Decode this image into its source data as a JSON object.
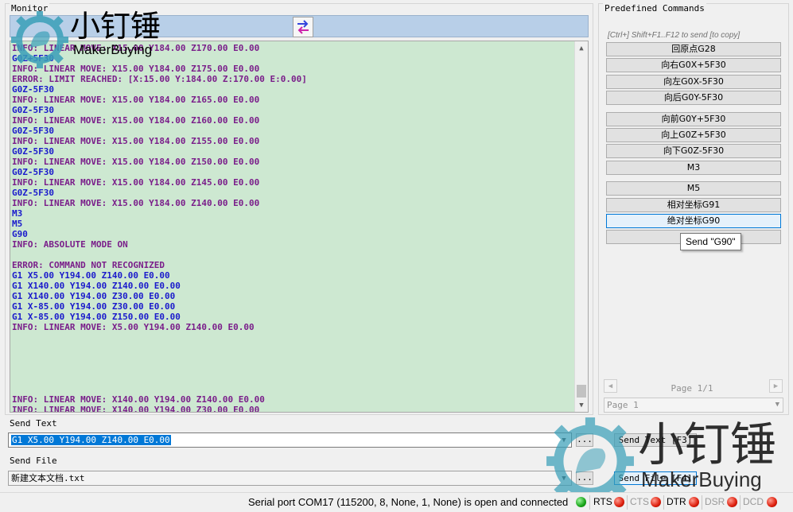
{
  "monitor": {
    "title": "Monitor",
    "lines": [
      {
        "text": "INFO: LINEAR MOVE: X15.00 Y184.00 Z170.00 E0.00",
        "kind": "info"
      },
      {
        "text": "G0Z+5F30",
        "kind": "cmd"
      },
      {
        "text": "INFO: LINEAR MOVE: X15.00 Y184.00 Z175.00 E0.00",
        "kind": "info"
      },
      {
        "text": "ERROR: LIMIT REACHED: [X:15.00 Y:184.00 Z:170.00 E:0.00]",
        "kind": "error"
      },
      {
        "text": "G0Z-5F30",
        "kind": "cmd"
      },
      {
        "text": "INFO: LINEAR MOVE: X15.00 Y184.00 Z165.00 E0.00",
        "kind": "info"
      },
      {
        "text": "G0Z-5F30",
        "kind": "cmd"
      },
      {
        "text": "INFO: LINEAR MOVE: X15.00 Y184.00 Z160.00 E0.00",
        "kind": "info"
      },
      {
        "text": "G0Z-5F30",
        "kind": "cmd"
      },
      {
        "text": "INFO: LINEAR MOVE: X15.00 Y184.00 Z155.00 E0.00",
        "kind": "info"
      },
      {
        "text": "G0Z-5F30",
        "kind": "cmd"
      },
      {
        "text": "INFO: LINEAR MOVE: X15.00 Y184.00 Z150.00 E0.00",
        "kind": "info"
      },
      {
        "text": "G0Z-5F30",
        "kind": "cmd"
      },
      {
        "text": "INFO: LINEAR MOVE: X15.00 Y184.00 Z145.00 E0.00",
        "kind": "info"
      },
      {
        "text": "G0Z-5F30",
        "kind": "cmd"
      },
      {
        "text": "INFO: LINEAR MOVE: X15.00 Y184.00 Z140.00 E0.00",
        "kind": "info"
      },
      {
        "text": "M3",
        "kind": "cmd"
      },
      {
        "text": "M5",
        "kind": "cmd"
      },
      {
        "text": "G90",
        "kind": "cmd"
      },
      {
        "text": "INFO: ABSOLUTE MODE ON",
        "kind": "info"
      },
      {
        "text": "",
        "kind": "info"
      },
      {
        "text": "ERROR: COMMAND NOT RECOGNIZED",
        "kind": "error"
      },
      {
        "text": "G1 X5.00 Y194.00 Z140.00 E0.00",
        "kind": "cmd"
      },
      {
        "text": "G1 X140.00 Y194.00 Z140.00 E0.00",
        "kind": "cmd"
      },
      {
        "text": "G1 X140.00 Y194.00 Z30.00 E0.00",
        "kind": "cmd"
      },
      {
        "text": "G1 X-85.00 Y194.00 Z30.00 E0.00",
        "kind": "cmd"
      },
      {
        "text": "G1 X-85.00 Y194.00 Z150.00 E0.00",
        "kind": "cmd"
      },
      {
        "text": "INFO: LINEAR MOVE: X5.00 Y194.00 Z140.00 E0.00",
        "kind": "info"
      },
      {
        "text": "",
        "kind": "info"
      },
      {
        "text": "",
        "kind": "info"
      },
      {
        "text": "",
        "kind": "info"
      },
      {
        "text": "",
        "kind": "info"
      },
      {
        "text": "",
        "kind": "info"
      },
      {
        "text": "",
        "kind": "info"
      },
      {
        "text": "INFO: LINEAR MOVE: X140.00 Y194.00 Z140.00 E0.00",
        "kind": "info"
      },
      {
        "text": "INFO: LINEAR MOVE: X140.00 Y194.00 Z30.00 E0.00",
        "kind": "info"
      }
    ]
  },
  "logo": {
    "cn": "小钉锤",
    "en": "MakerBuying"
  },
  "predefined": {
    "title": "Predefined Commands",
    "hint": "[Ctrl+] Shift+F1..F12 to send [to copy]",
    "buttons": [
      {
        "label": "回原点G28"
      },
      {
        "label": "向右G0X+5F30"
      },
      {
        "label": "向左G0X-5F30"
      },
      {
        "label": "向后G0Y-5F30"
      },
      {
        "label": "向前G0Y+5F30"
      },
      {
        "label": "向上G0Z+5F30"
      },
      {
        "label": "向下G0Z-5F30"
      },
      {
        "label": "M3"
      },
      {
        "label": "M5"
      },
      {
        "label": "相对坐标G91"
      },
      {
        "label": "绝对坐标G90"
      },
      {
        "label": ""
      }
    ],
    "tooltip": "Send \"G90\"",
    "page_label": "Page 1/1",
    "page_select": "Page 1"
  },
  "send_text": {
    "label": "Send Text",
    "value": "G1 X5.00 Y194.00 Z140.00 E0.00",
    "dots": "...",
    "button": "Send Text [F3]"
  },
  "send_file": {
    "label": "Send File",
    "value": "新建文本文档.txt",
    "dots": "...",
    "button": "Send File [F4]"
  },
  "status": {
    "text": "Serial port COM17 (115200, 8, None, 1, None) is open and connected",
    "signals": [
      {
        "name": "RTS",
        "state": "on"
      },
      {
        "name": "CTS",
        "state": "off"
      },
      {
        "name": "DTR",
        "state": "on"
      },
      {
        "name": "DSR",
        "state": "off"
      },
      {
        "name": "DCD",
        "state": "off"
      }
    ]
  },
  "colors": {
    "log_bg": "#cde8d1",
    "info": "#7a1e8a",
    "cmd": "#1a1acc",
    "toolbar": "#b8cfe8",
    "led_green": "#17a417",
    "led_red": "#dd1e0c"
  }
}
